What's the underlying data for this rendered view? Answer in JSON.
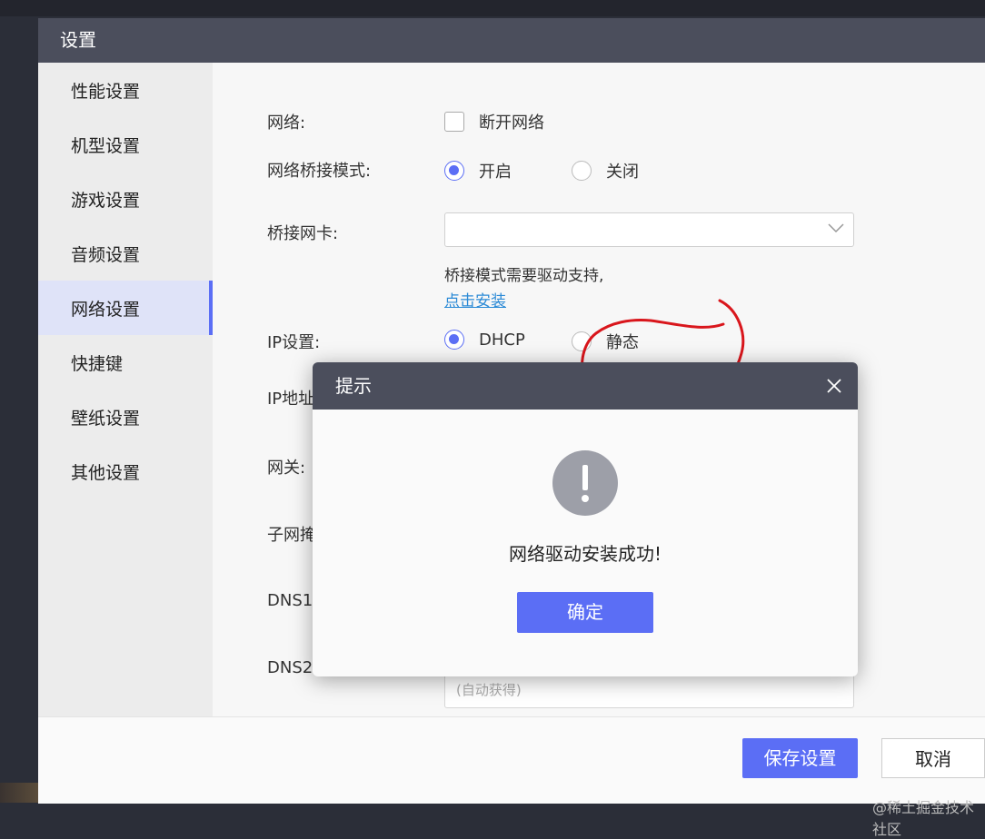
{
  "window": {
    "title": "设置"
  },
  "sidebar": {
    "items": [
      {
        "label": "性能设置"
      },
      {
        "label": "机型设置"
      },
      {
        "label": "游戏设置"
      },
      {
        "label": "音频设置"
      },
      {
        "label": "网络设置",
        "active": true
      },
      {
        "label": "快捷键"
      },
      {
        "label": "壁纸设置"
      },
      {
        "label": "其他设置"
      }
    ]
  },
  "network": {
    "network_label": "网络:",
    "disconnect_label": "断开网络",
    "disconnect_checked": false,
    "bridge_mode_label": "网络桥接模式:",
    "bridge_on_label": "开启",
    "bridge_off_label": "关闭",
    "bridge_selected": "开启",
    "bridge_nic_label": "桥接网卡:",
    "bridge_nic_value": "",
    "hint_text": "桥接模式需要驱动支持,",
    "install_link": "点击安装",
    "ip_label": "IP设置:",
    "ip_dhcp_label": "DHCP",
    "ip_static_label": "静态",
    "ip_selected": "DHCP",
    "ip_addr_label": "IP地址",
    "gateway_label": "网关:",
    "subnet_label": "子网掩",
    "dns1_label": "DNS1",
    "dns2_label": "DNS2",
    "dns2_placeholder": "(自动获得)"
  },
  "footer": {
    "save_label": "保存设置",
    "cancel_label": "取消"
  },
  "dialog": {
    "title": "提示",
    "message": "网络驱动安装成功!",
    "ok_label": "确定"
  },
  "watermark": "@稀土掘金技术社区",
  "colors": {
    "accent": "#5b6ef5",
    "titlebar": "#4b4e5c",
    "link": "#2b8ad6",
    "annotation": "#d9161c"
  }
}
